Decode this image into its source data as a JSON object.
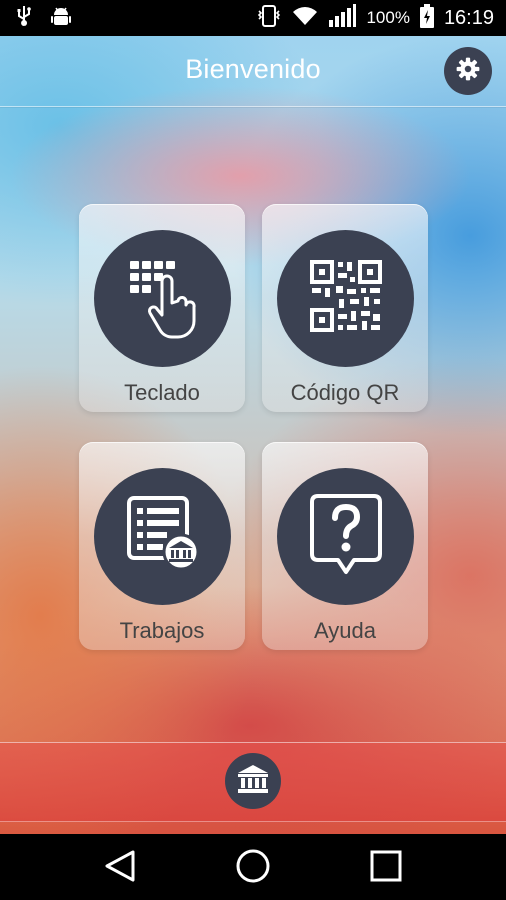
{
  "status_bar": {
    "icons_left": [
      "usb-icon",
      "android-debug-icon"
    ],
    "icons_right": [
      "vibrate-icon",
      "wifi-icon",
      "signal-icon",
      "battery-icon"
    ],
    "battery": "100%",
    "time": "16:19"
  },
  "header": {
    "title": "Bienvenido",
    "settings_icon": "gear-icon"
  },
  "tiles": [
    {
      "label": "Teclado",
      "icon": "keypad-hand-icon"
    },
    {
      "label": "Código QR",
      "icon": "qr-code-icon"
    },
    {
      "label": "Trabajos",
      "icon": "job-list-bank-icon"
    },
    {
      "label": "Ayuda",
      "icon": "help-question-icon"
    }
  ],
  "footer": {
    "icon": "bank-icon"
  },
  "nav": {
    "icons": [
      "back-icon",
      "home-icon",
      "recents-icon"
    ]
  },
  "colors": {
    "dark_circle": "#3b4152",
    "title_text": "#ffffff",
    "tile_label": "#444444"
  }
}
